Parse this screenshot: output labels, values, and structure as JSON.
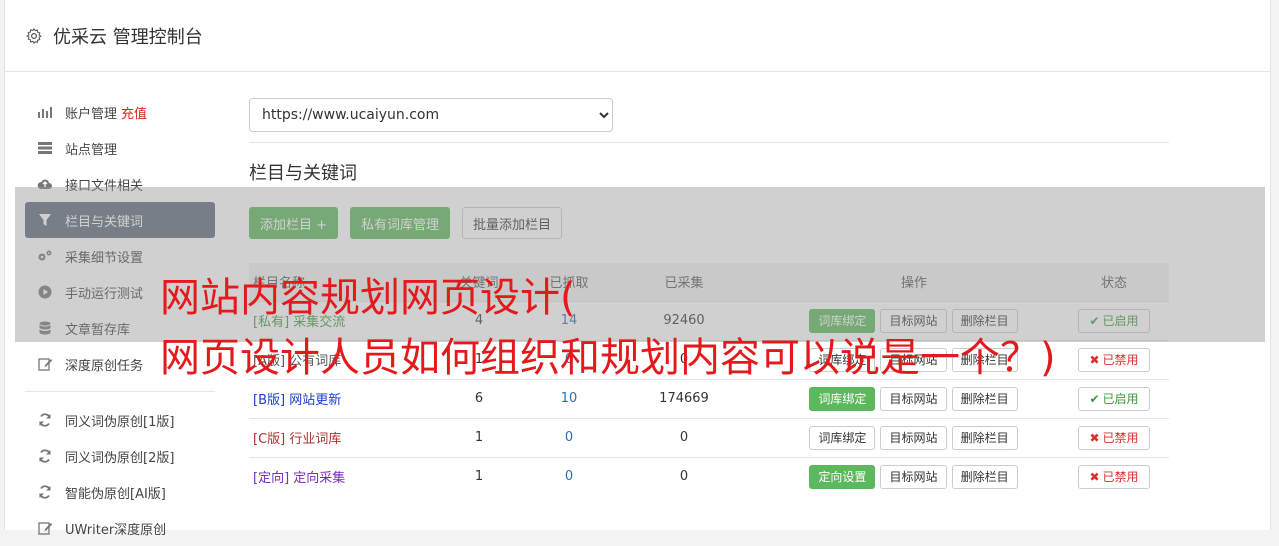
{
  "header": {
    "title": "优采云 管理控制台"
  },
  "sidebar": {
    "items": [
      {
        "label": "账户管理",
        "extra": "充值"
      },
      {
        "label": "站点管理"
      },
      {
        "label": "接口文件相关"
      },
      {
        "label": "栏目与关键词"
      },
      {
        "label": "采集细节设置"
      },
      {
        "label": "手动运行测试"
      },
      {
        "label": "文章暂存库"
      },
      {
        "label": "深度原创任务"
      },
      {
        "label": "同义词伪原创[1版]"
      },
      {
        "label": "同义词伪原创[2版]"
      },
      {
        "label": "智能伪原创[AI版]"
      },
      {
        "label": "UWriter深度原创"
      }
    ]
  },
  "main": {
    "site_select": "https://www.ucaiyun.com",
    "section_title": "栏目与关键词",
    "buttons": {
      "add": "添加栏目 +",
      "private": "私有词库管理",
      "batch": "批量添加栏目"
    }
  },
  "table": {
    "headers": [
      "栏目名称",
      "关键词",
      "已抓取",
      "已采集",
      "操作",
      "状态"
    ],
    "rows": [
      {
        "tag": "[私有]",
        "name": "采集交流",
        "kw": "4",
        "fetched": "14",
        "collected": "92460",
        "op1": "词库绑定",
        "op2": "目标网站",
        "op3": "删除栏目",
        "status": "已启用",
        "color": "#3c9a3c"
      },
      {
        "tag": "[A版]",
        "name": "公有词库",
        "kw": "1",
        "fetched": "0",
        "collected": "0",
        "op1": "词库绑定",
        "op2": "目标网站",
        "op3": "删除栏目",
        "status": "已禁用",
        "color": "#555555"
      },
      {
        "tag": "[B版]",
        "name": "网站更新",
        "kw": "6",
        "fetched": "10",
        "collected": "174669",
        "op1": "词库绑定",
        "op2": "目标网站",
        "op3": "删除栏目",
        "status": "已启用",
        "color": "#1a3ec8"
      },
      {
        "tag": "[C版]",
        "name": "行业词库",
        "kw": "1",
        "fetched": "0",
        "collected": "0",
        "op1": "词库绑定",
        "op2": "目标网站",
        "op3": "删除栏目",
        "status": "已禁用",
        "color": "#b03030"
      },
      {
        "tag": "[定向]",
        "name": "定向采集",
        "kw": "1",
        "fetched": "0",
        "collected": "0",
        "op1": "定向设置",
        "op2": "目标网站",
        "op3": "删除栏目",
        "status": "已禁用",
        "color": "#7a2cc0"
      }
    ]
  },
  "overlay": {
    "line1": "网站内容规划网页设计(",
    "line2": "网页设计人员如何组织和规划内容可以说是一个？)"
  }
}
